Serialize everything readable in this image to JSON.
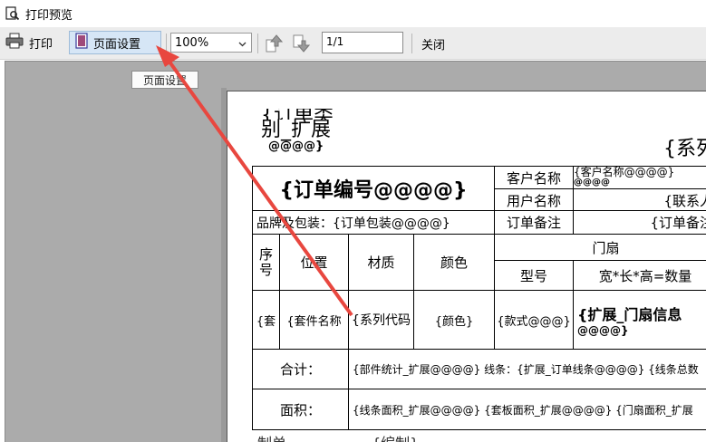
{
  "window": {
    "title": "打印预览"
  },
  "toolbar": {
    "print_label": "打印",
    "page_setup_label": "页面设置",
    "zoom_value": "100%",
    "page_value": "1/1",
    "close_label": "关闭"
  },
  "tooltip": {
    "text": "页面设置"
  },
  "report": {
    "order_category_line1": "{订单类",
    "order_category_line2": "别_扩展",
    "order_category_line3": "@@@@}",
    "system_title": "{系列",
    "order_number": "{订单编号@@@@}",
    "customer_name_label": "客户名称",
    "customer_name_value": "{客户名称@@@@}",
    "customer_name_value2": "@@@@",
    "user_name_label": "用户名称",
    "contact_value": "{联系人",
    "brand_pack": "品牌及包装：{订单包装@@@@}",
    "order_note_label": "订单备注",
    "order_note_value": "{订单备注",
    "col_seq": "序号",
    "col_position": "位置",
    "col_material": "材质",
    "col_color": "颜色",
    "col_door_fan": "门扇",
    "col_model": "型号",
    "col_dims": "宽*长*高=数量",
    "row_seq": "{套",
    "row_set_name": "{套件名称",
    "row_series_code": "{系列代码",
    "row_color": "{颜色}",
    "row_style": "{款式@@@}",
    "row_door_info": "{扩展_门扇信息",
    "row_door_info2": "@@@@}",
    "total_label": "合计：",
    "total_value": "{部件统计_扩展@@@@} 线条：{扩展_订单线条@@@@} {线条总数",
    "area_label": "面积：",
    "area_value": "{线条面积_扩展@@@@} {套板面积_扩展@@@@} {门扇面积_扩展",
    "footer_maker": "制单",
    "footer_maker_value": "{编制}"
  },
  "colors": {
    "annotation_arrow": "#e8473f",
    "page_setup_highlight": "#d6e6f6",
    "preview_background": "#ababab"
  }
}
